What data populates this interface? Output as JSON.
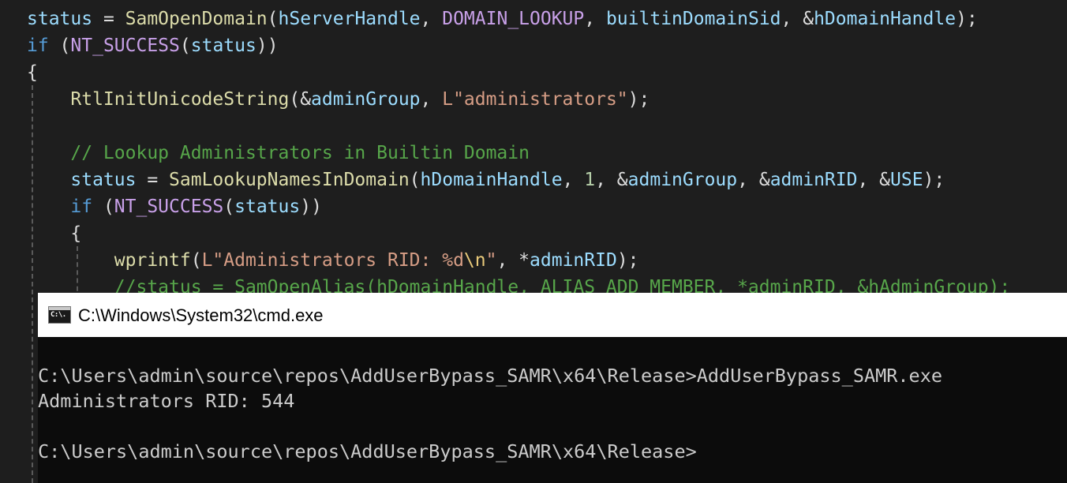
{
  "editor": {
    "lines": [
      [
        {
          "t": "status",
          "c": "var"
        },
        {
          "t": " = ",
          "c": "pun"
        },
        {
          "t": "SamOpenDomain",
          "c": "fn"
        },
        {
          "t": "(",
          "c": "pun"
        },
        {
          "t": "hServerHandle",
          "c": "var"
        },
        {
          "t": ", ",
          "c": "pun"
        },
        {
          "t": "DOMAIN_LOOKUP",
          "c": "macro"
        },
        {
          "t": ", ",
          "c": "pun"
        },
        {
          "t": "builtinDomainSid",
          "c": "var"
        },
        {
          "t": ", &",
          "c": "pun"
        },
        {
          "t": "hDomainHandle",
          "c": "var"
        },
        {
          "t": ");",
          "c": "pun"
        }
      ],
      [
        {
          "t": "if",
          "c": "kw"
        },
        {
          "t": " (",
          "c": "pun"
        },
        {
          "t": "NT_SUCCESS",
          "c": "macro"
        },
        {
          "t": "(",
          "c": "pun"
        },
        {
          "t": "status",
          "c": "var"
        },
        {
          "t": "))",
          "c": "pun"
        }
      ],
      [
        {
          "t": "{",
          "c": "pun"
        }
      ],
      [
        {
          "t": "    ",
          "c": "pun"
        },
        {
          "t": "RtlInitUnicodeString",
          "c": "fn"
        },
        {
          "t": "(&",
          "c": "pun"
        },
        {
          "t": "adminGroup",
          "c": "var"
        },
        {
          "t": ", ",
          "c": "pun"
        },
        {
          "t": "L\"administrators\"",
          "c": "str"
        },
        {
          "t": ");",
          "c": "pun"
        }
      ],
      [],
      [
        {
          "t": "    ",
          "c": "pun"
        },
        {
          "t": "// Lookup Administrators in Builtin Domain",
          "c": "cmt"
        }
      ],
      [
        {
          "t": "    ",
          "c": "pun"
        },
        {
          "t": "status",
          "c": "var"
        },
        {
          "t": " = ",
          "c": "pun"
        },
        {
          "t": "SamLookupNamesInDomain",
          "c": "fn"
        },
        {
          "t": "(",
          "c": "pun"
        },
        {
          "t": "hDomainHandle",
          "c": "var"
        },
        {
          "t": ", ",
          "c": "pun"
        },
        {
          "t": "1",
          "c": "num"
        },
        {
          "t": ", &",
          "c": "pun"
        },
        {
          "t": "adminGroup",
          "c": "var"
        },
        {
          "t": ", &",
          "c": "pun"
        },
        {
          "t": "adminRID",
          "c": "var"
        },
        {
          "t": ", &",
          "c": "pun"
        },
        {
          "t": "USE",
          "c": "var"
        },
        {
          "t": ");",
          "c": "pun"
        }
      ],
      [
        {
          "t": "    ",
          "c": "pun"
        },
        {
          "t": "if",
          "c": "kw"
        },
        {
          "t": " (",
          "c": "pun"
        },
        {
          "t": "NT_SUCCESS",
          "c": "macro"
        },
        {
          "t": "(",
          "c": "pun"
        },
        {
          "t": "status",
          "c": "var"
        },
        {
          "t": "))",
          "c": "pun"
        }
      ],
      [
        {
          "t": "    ",
          "c": "pun"
        },
        {
          "t": "{",
          "c": "pun"
        }
      ],
      [
        {
          "t": "        ",
          "c": "pun"
        },
        {
          "t": "wprintf",
          "c": "fn"
        },
        {
          "t": "(",
          "c": "pun"
        },
        {
          "t": "L\"Administrators RID: %d",
          "c": "str"
        },
        {
          "t": "\\n",
          "c": "esc"
        },
        {
          "t": "\"",
          "c": "str"
        },
        {
          "t": ", *",
          "c": "pun"
        },
        {
          "t": "adminRID",
          "c": "var"
        },
        {
          "t": ");",
          "c": "pun"
        }
      ],
      [
        {
          "t": "        ",
          "c": "pun"
        },
        {
          "t": "//status = SamOpenAlias(hDomainHandle, ALIAS_ADD_MEMBER, *adminRID, &hAdminGroup);",
          "c": "cmt"
        }
      ]
    ]
  },
  "cmd": {
    "title": "C:\\Windows\\System32\\cmd.exe",
    "icon": "cmd-icon",
    "icon_glyph": "C:\\.",
    "lines": [
      "",
      "C:\\Users\\admin\\source\\repos\\AddUserBypass_SAMR\\x64\\Release>AddUserBypass_SAMR.exe",
      "Administrators RID: 544",
      "",
      "C:\\Users\\admin\\source\\repos\\AddUserBypass_SAMR\\x64\\Release>"
    ]
  }
}
